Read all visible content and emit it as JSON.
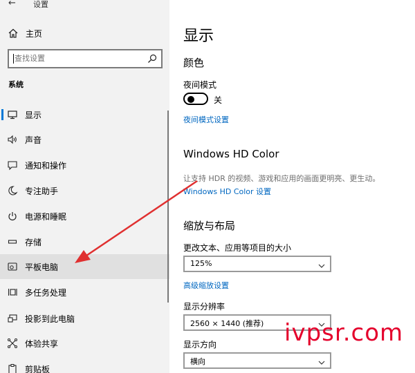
{
  "window": {
    "title": "设置"
  },
  "sidebar": {
    "home_label": "主页",
    "search_placeholder": "查找设置",
    "section_label": "系统",
    "items": [
      {
        "label": "显示",
        "icon": "monitor-icon",
        "active": false
      },
      {
        "label": "声音",
        "icon": "speaker-icon",
        "active": false
      },
      {
        "label": "通知和操作",
        "icon": "notification-icon",
        "active": false
      },
      {
        "label": "专注助手",
        "icon": "moon-icon",
        "active": false
      },
      {
        "label": "电源和睡眠",
        "icon": "power-icon",
        "active": false
      },
      {
        "label": "存储",
        "icon": "storage-icon",
        "active": false
      },
      {
        "label": "平板电脑",
        "icon": "tablet-icon",
        "active": true
      },
      {
        "label": "多任务处理",
        "icon": "multitask-icon",
        "active": false
      },
      {
        "label": "投影到此电脑",
        "icon": "project-icon",
        "active": false
      },
      {
        "label": "体验共享",
        "icon": "share-icon",
        "active": false
      },
      {
        "label": "剪贴板",
        "icon": "clipboard-icon",
        "active": false
      }
    ]
  },
  "main": {
    "title": "显示",
    "color": {
      "heading": "颜色",
      "night_mode_label": "夜间模式",
      "night_mode_state": "关",
      "night_mode_link": "夜间模式设置"
    },
    "hdr": {
      "heading": "Windows HD Color",
      "description": "让支持 HDR 的视频、游戏和应用的画面更明亮、更生动。",
      "link": "Windows HD Color 设置"
    },
    "scale": {
      "heading": "缩放与布局",
      "size_label": "更改文本、应用等项目的大小",
      "size_value": "125%",
      "advanced_link": "高级缩放设置",
      "resolution_label": "显示分辨率",
      "resolution_value": "2560 × 1440 (推荐)",
      "orientation_label": "显示方向",
      "orientation_value": "横向"
    }
  },
  "watermark": "ivpsr.com",
  "colors": {
    "accent": "#0078d7",
    "link": "#0067c0",
    "arrow": "#e03030",
    "watermark": "#e4002b"
  }
}
